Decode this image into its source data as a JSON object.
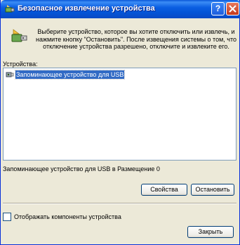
{
  "window": {
    "title": "Безопасное извлечение устройства",
    "help_label": "?"
  },
  "intro": {
    "text": "Выберите устройство, которое вы хотите отключить или извлечь, и нажмите кнопку \"Остановить\". После извещения системы о том, что отключение устройства разрешено, отключите и извлеките его."
  },
  "devices": {
    "label": "Устройства:",
    "items": [
      {
        "label": "Запоминающее устройство для USB",
        "icon": "usb-drive-icon",
        "selected": true
      }
    ],
    "description": "Запоминающее устройство для USB в Размещение 0"
  },
  "buttons": {
    "properties": "Свойства",
    "stop": "Остановить",
    "close": "Закрыть"
  },
  "options": {
    "show_components_label": "Отображать компоненты устройства",
    "show_components_checked": false
  },
  "colors": {
    "titlebar": "#0454d6",
    "window_bg": "#ece9d8",
    "selection": "#316ac5",
    "close_button": "#c5391a"
  }
}
